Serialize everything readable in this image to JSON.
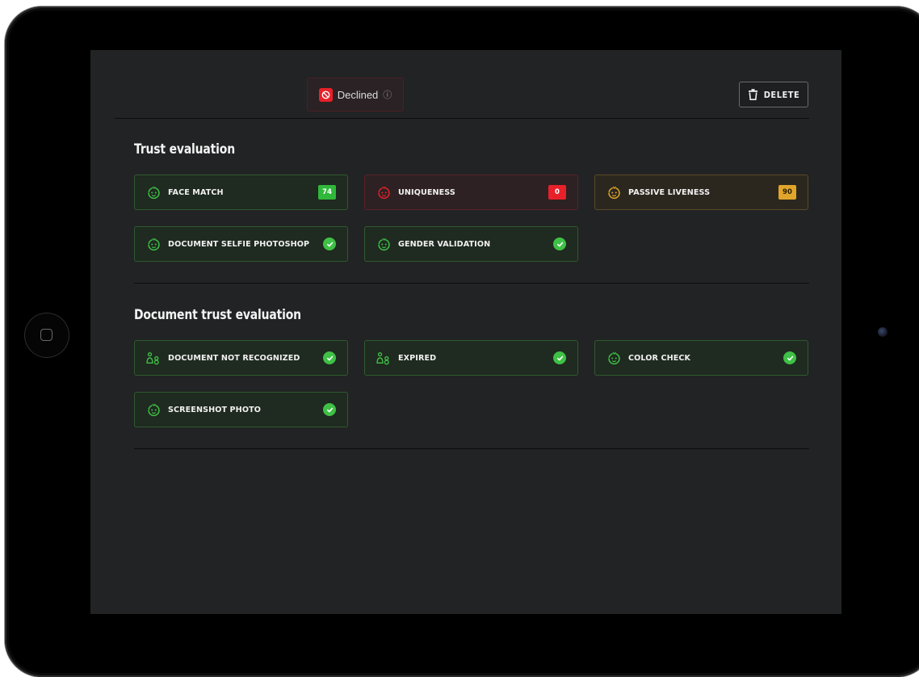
{
  "status": {
    "label": "Declined",
    "info_glyph": "ⓘ",
    "icon": "ban-icon",
    "color": "#e8202a"
  },
  "toolbar": {
    "delete_label": "DELETE",
    "delete_icon": "trash-icon"
  },
  "trust_evaluation": {
    "title": "Trust evaluation",
    "items": [
      {
        "label": "FACE MATCH",
        "icon": "face-icon",
        "state": "green",
        "badge": "74"
      },
      {
        "label": "UNIQUENESS",
        "icon": "face-icon",
        "state": "red",
        "badge": "0"
      },
      {
        "label": "PASSIVE LIVENESS",
        "icon": "face-icon",
        "state": "amber",
        "badge": "90"
      },
      {
        "label": "DOCUMENT SELFIE PHOTOSHOP",
        "icon": "face-icon",
        "state": "green",
        "check": true
      },
      {
        "label": "GENDER VALIDATION",
        "icon": "face-icon",
        "state": "green",
        "check": true
      }
    ]
  },
  "document_trust_evaluation": {
    "title": "Document trust evaluation",
    "items": [
      {
        "label": "DOCUMENT NOT RECOGNIZED",
        "icon": "person-id-icon",
        "state": "green",
        "check": true
      },
      {
        "label": "EXPIRED",
        "icon": "person-id-icon",
        "state": "green",
        "check": true
      },
      {
        "label": "COLOR CHECK",
        "icon": "face-icon",
        "state": "green",
        "check": true
      },
      {
        "label": "SCREENSHOT PHOTO",
        "icon": "face-icon",
        "state": "green",
        "check": true
      }
    ]
  },
  "colors": {
    "green": "#3fc046",
    "red": "#e8202a",
    "amber": "#e0a52a",
    "screen_bg": "#222324"
  }
}
